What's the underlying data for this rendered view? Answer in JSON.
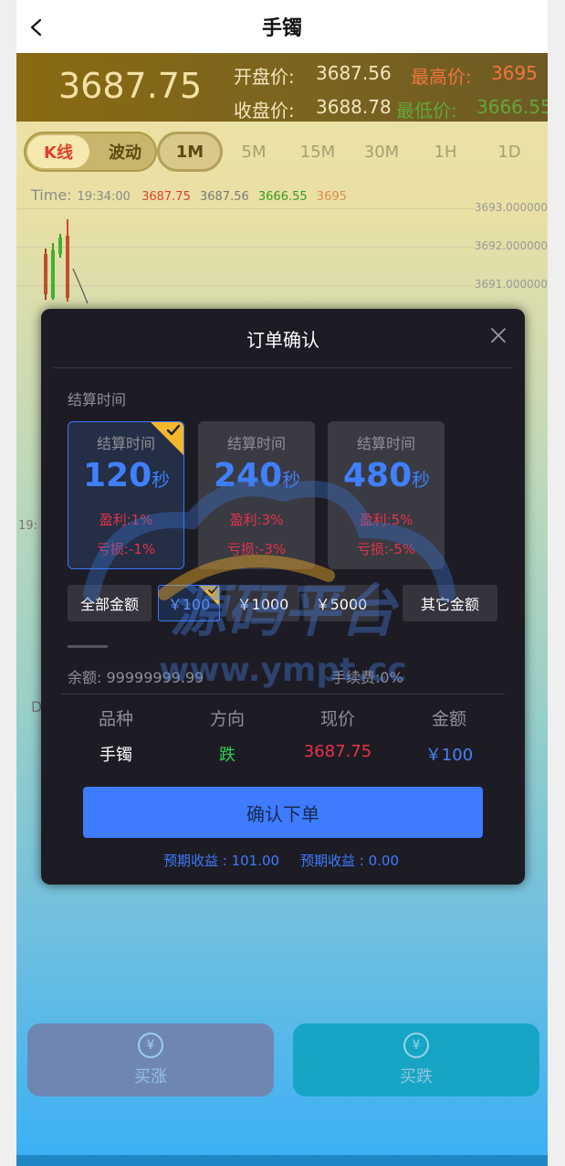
{
  "header": {
    "title": "手镯",
    "back_icon": "chevron-left-icon"
  },
  "quote": {
    "price": "3687.75",
    "open_label": "开盘价:",
    "open_value": "3687.56",
    "close_label": "收盘价:",
    "close_value": "3688.78",
    "high_label": "最高价:",
    "high_value": "3695",
    "low_label": "最低价:",
    "low_value": "3666.55",
    "colors": {
      "high": "#f0763a",
      "low": "#62a83a",
      "price": "#f3e2a6"
    }
  },
  "chart_tabs": {
    "kline": "K线",
    "wave": "波动",
    "timeframes": [
      "1M",
      "5M",
      "15M",
      "30M",
      "1H",
      "1D"
    ],
    "active_timeframe": "1M"
  },
  "chart": {
    "time_label": "Time:",
    "time_value": "19:34:00",
    "ohlc": [
      "3687.75",
      "3687.56",
      "3666.55",
      "3695"
    ],
    "ohlc_colors": [
      "#e2402c",
      "#7a7a7a",
      "#3a9a20",
      "#e08a50"
    ],
    "y_ticks": [
      "3693.000000",
      "3692.000000",
      "3691.000000"
    ],
    "side_time": "19:",
    "side_letter": "D"
  },
  "modal": {
    "title": "订单确认",
    "close_icon": "close-icon",
    "settle_label": "结算时间",
    "time_cards": [
      {
        "header": "结算时间",
        "seconds": "120",
        "unit": "秒",
        "profit": "盈利:1%",
        "loss": "亏损:-1%",
        "selected": true
      },
      {
        "header": "结算时间",
        "seconds": "240",
        "unit": "秒",
        "profit": "盈利:3%",
        "loss": "亏损:-3%",
        "selected": false
      },
      {
        "header": "结算时间",
        "seconds": "480",
        "unit": "秒",
        "profit": "盈利:5%",
        "loss": "亏损:-5%",
        "selected": false
      }
    ],
    "amounts": [
      "全部金额",
      "￥100",
      "￥1000",
      "￥5000",
      "其它金额"
    ],
    "selected_amount": "￥100",
    "balance": "余额: 99999999.99",
    "fee": "手续费:0%",
    "table": {
      "headers": [
        "品种",
        "方向",
        "现价",
        "金额"
      ],
      "values": [
        "手镯",
        "跌",
        "3687.75",
        "￥100"
      ],
      "colors": [
        "#ffffff",
        "#2fcf55",
        "#e8334a",
        "#4a7fff"
      ]
    },
    "confirm_label": "确认下单",
    "expected_1": "预期收益 : 101.00",
    "expected_2": "预期收益 : 0.00"
  },
  "bottom": {
    "buy_up": "买涨",
    "buy_down": "买跌",
    "coin_icon": "yuan-coin-icon"
  },
  "watermark": {
    "line1": "源码平台",
    "line2": "www.ympt.cc"
  }
}
